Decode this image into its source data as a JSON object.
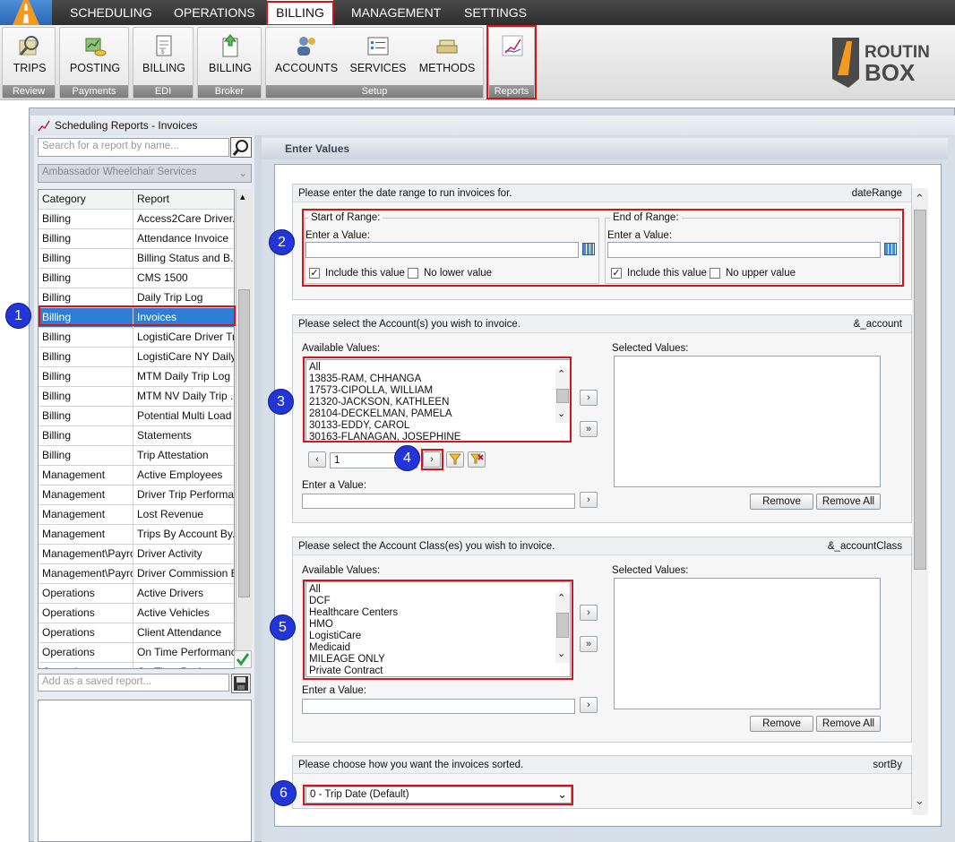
{
  "menu": {
    "items": [
      "SCHEDULING",
      "OPERATIONS",
      "BILLING",
      "MANAGEMENT",
      "SETTINGS"
    ],
    "active": "BILLING"
  },
  "ribbon": {
    "buttons": [
      "TRIPS",
      "POSTING",
      "BILLING",
      "BILLING",
      "ACCOUNTS",
      "SERVICES",
      "METHODS"
    ],
    "groups": [
      "Review",
      "Payments",
      "EDI",
      "Broker",
      "Setup",
      "Reports"
    ]
  },
  "brand": {
    "line1": "ROUTIN",
    "line2": "BOX"
  },
  "window": {
    "title": "Scheduling Reports - Invoices"
  },
  "left": {
    "search_placeholder": "Search for a report by name...",
    "company": "Ambassador Wheelchair Services",
    "grid_headers": [
      "Category",
      "Report"
    ],
    "rows": [
      [
        "Billing",
        "Access2Care Driver..."
      ],
      [
        "Billing",
        "Attendance Invoice"
      ],
      [
        "Billing",
        "Billing Status and B..."
      ],
      [
        "Billing",
        "CMS 1500"
      ],
      [
        "Billing",
        "Daily Trip Log"
      ],
      [
        "Billing",
        "Invoices"
      ],
      [
        "Billing",
        "LogistiCare Driver Tr..."
      ],
      [
        "Billing",
        "LogistiCare NY Daily..."
      ],
      [
        "Billing",
        "MTM Daily Trip Log"
      ],
      [
        "Billing",
        "MTM NV Daily Trip ..."
      ],
      [
        "Billing",
        "Potential Multi Load ..."
      ],
      [
        "Billing",
        "Statements"
      ],
      [
        "Billing",
        "Trip Attestation"
      ],
      [
        "Management",
        "Active Employees"
      ],
      [
        "Management",
        "Driver Trip Performa..."
      ],
      [
        "Management",
        "Lost Revenue"
      ],
      [
        "Management",
        "Trips By Account By..."
      ],
      [
        "Management\\Payroll",
        "Driver Activity"
      ],
      [
        "Management\\Payroll",
        "Driver Commission B..."
      ],
      [
        "Operations",
        "Active Drivers"
      ],
      [
        "Operations",
        "Active Vehicles"
      ],
      [
        "Operations",
        "Client Attendance"
      ],
      [
        "Operations",
        "On Time Performance"
      ],
      [
        "Operations",
        "On Time Perf..."
      ]
    ],
    "selected_row": 5,
    "save_placeholder": "Add as a saved report..."
  },
  "main": {
    "header": "Enter Values",
    "date": {
      "prompt": "Please enter the date range to run invoices for.",
      "param": "dateRange",
      "start": "Start of Range:",
      "end": "End of Range:",
      "enter": "Enter a Value:",
      "include": "Include this value",
      "no_lower": "No lower value",
      "no_upper": "No upper value"
    },
    "account": {
      "prompt": "Please select the Account(s) you wish to invoice.",
      "param": "&_account",
      "available": "Available Values:",
      "selected": "Selected Values:",
      "values": [
        "All",
        "13835-RAM, CHHANGA",
        "17573-CIPOLLA, WILLIAM",
        "21320-JACKSON, KATHLEEN",
        "28104-DECKELMAN, PAMELA",
        "30133-EDDY, CAROL",
        "30163-FLANAGAN, JOSEPHINE"
      ],
      "page": "1",
      "enter": "Enter a Value:",
      "remove": "Remove",
      "remove_all": "Remove All"
    },
    "acct_class": {
      "prompt": "Please select the Account Class(es) you wish to invoice.",
      "param": "&_accountClass",
      "available": "Available Values:",
      "selected": "Selected Values:",
      "values": [
        "All",
        "DCF",
        "Healthcare Centers",
        "HMO",
        "LogistiCare",
        "Medicaid",
        "MILEAGE ONLY",
        "Private Contract"
      ],
      "enter": "Enter a Value:",
      "remove": "Remove",
      "remove_all": "Remove All"
    },
    "sort": {
      "prompt": "Please choose how you want the invoices sorted.",
      "param": "sortBy",
      "value": "0 - Trip Date (Default)"
    }
  },
  "badges": [
    "1",
    "2",
    "3",
    "4",
    "5",
    "6"
  ]
}
